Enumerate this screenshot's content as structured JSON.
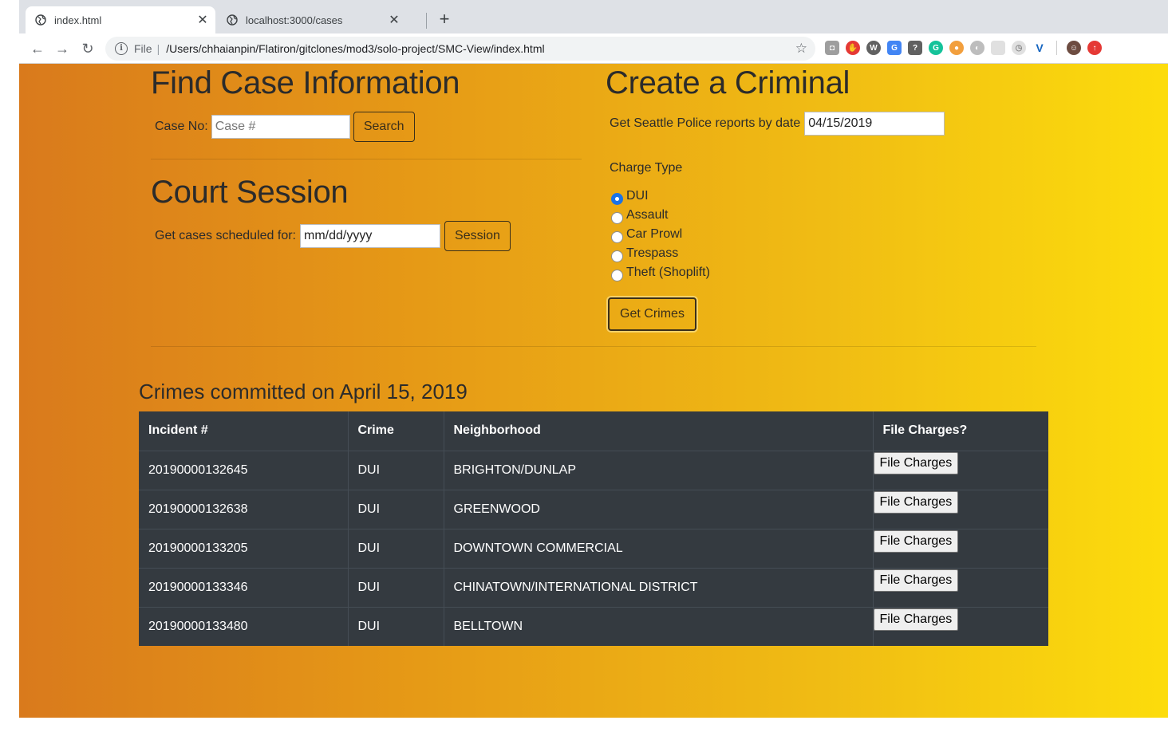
{
  "browser": {
    "tabs": [
      {
        "title": "index.html",
        "active": true
      },
      {
        "title": "localhost:3000/cases",
        "active": false
      }
    ],
    "new_tab_label": "+",
    "address": {
      "scheme": "File",
      "path": "/Users/chhaianpin/Flatiron/gitclones/mod3/solo-project/SMC-View/index.html"
    },
    "extensions": [
      {
        "name": "camera-extension-icon",
        "color": "#9e9e9e"
      },
      {
        "name": "adblock-extension-icon",
        "color": "#e53935"
      },
      {
        "name": "wordpress-extension-icon",
        "color": "#616161"
      },
      {
        "name": "google-translate-extension-icon",
        "color": "#4285f4"
      },
      {
        "name": "help-extension-icon",
        "color": "#616161"
      },
      {
        "name": "grammarly-extension-icon",
        "color": "#15c39a"
      },
      {
        "name": "cookie-extension-icon",
        "color": "#f29f3d"
      },
      {
        "name": "grey-circle-extension-icon",
        "color": "#bdbdbd"
      },
      {
        "name": "blank-extension-icon",
        "color": "#e0e0e0"
      },
      {
        "name": "timer-extension-icon",
        "color": "#e0e0e0"
      },
      {
        "name": "vue-devtools-extension-icon",
        "color": "#1565c0"
      },
      {
        "name": "profile-avatar-icon",
        "color": "#6d4c41"
      },
      {
        "name": "update-extension-icon",
        "color": "#e53935"
      }
    ]
  },
  "find_case": {
    "title": "Find Case Information",
    "case_label": "Case No:",
    "case_placeholder": "Case #",
    "search_label": "Search"
  },
  "court_session": {
    "title": "Court Session",
    "label": "Get cases scheduled for:",
    "date_value": "mm/dd/yyyy",
    "session_label": "Session"
  },
  "create_criminal": {
    "title": "Create a Criminal",
    "reports_label": "Get Seattle Police reports by date",
    "report_date": "04/15/2019",
    "charge_type_label": "Charge Type",
    "charge_types": [
      {
        "label": "DUI",
        "checked": true
      },
      {
        "label": "Assault",
        "checked": false
      },
      {
        "label": "Car Prowl",
        "checked": false
      },
      {
        "label": "Trespass",
        "checked": false
      },
      {
        "label": "Theft (Shoplift)",
        "checked": false
      }
    ],
    "get_crimes_label": "Get Crimes"
  },
  "crimes": {
    "heading": "Crimes committed on April 15, 2019",
    "columns": [
      "Incident #",
      "Crime",
      "Neighborhood",
      "File Charges?"
    ],
    "button_label": "File Charges",
    "rows": [
      {
        "incident": "20190000132645",
        "crime": "DUI",
        "neighborhood": "BRIGHTON/DUNLAP"
      },
      {
        "incident": "20190000132638",
        "crime": "DUI",
        "neighborhood": "GREENWOOD"
      },
      {
        "incident": "20190000133205",
        "crime": "DUI",
        "neighborhood": "DOWNTOWN COMMERCIAL"
      },
      {
        "incident": "20190000133346",
        "crime": "DUI",
        "neighborhood": "CHINATOWN/INTERNATIONAL DISTRICT"
      },
      {
        "incident": "20190000133480",
        "crime": "DUI",
        "neighborhood": "BELLTOWN"
      }
    ]
  }
}
